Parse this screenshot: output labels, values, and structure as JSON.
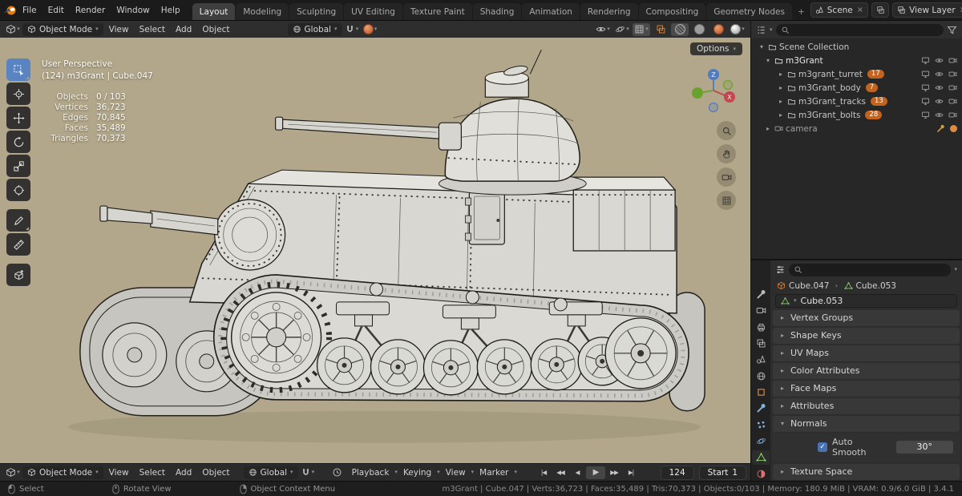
{
  "topbar": {
    "menus": [
      "File",
      "Edit",
      "Render",
      "Window",
      "Help"
    ],
    "tabs": [
      "Layout",
      "Modeling",
      "Sculpting",
      "UV Editing",
      "Texture Paint",
      "Shading",
      "Animation",
      "Rendering",
      "Compositing",
      "Geometry Nodes"
    ],
    "add_tab": "+",
    "scene_label": "Scene",
    "view_layer_label": "View Layer"
  },
  "viewport_header": {
    "mode": "Object Mode",
    "menus": [
      "View",
      "Select",
      "Add",
      "Object"
    ],
    "orientation": "Global",
    "options_label": "Options"
  },
  "viewport": {
    "view_label": "User Perspective",
    "object_label": "(124) m3Grant | Cube.047",
    "stats": [
      {
        "label": "Objects",
        "value": "0 / 103"
      },
      {
        "label": "Vertices",
        "value": "36,723"
      },
      {
        "label": "Edges",
        "value": "70,845"
      },
      {
        "label": "Faces",
        "value": "35,489"
      },
      {
        "label": "Triangles",
        "value": "70,373"
      }
    ],
    "gizmo": {
      "x": "X",
      "z": "Z"
    }
  },
  "outliner": {
    "root_label": "Scene Collection",
    "collection_label": "m3Grant",
    "children": [
      {
        "label": "m3grant_turret",
        "count": "17"
      },
      {
        "label": "m3Grant_body",
        "count": "7"
      },
      {
        "label": "m3Grant_tracks",
        "count": "13"
      },
      {
        "label": "m3Grant_bolts",
        "count": "28"
      }
    ],
    "camera_label": "camera"
  },
  "properties": {
    "breadcrumb_object": "Cube.047",
    "breadcrumb_data": "Cube.053",
    "data_name": "Cube.053",
    "panels": [
      "Vertex Groups",
      "Shape Keys",
      "UV Maps",
      "Color Attributes",
      "Face Maps",
      "Attributes"
    ],
    "normals_title": "Normals",
    "auto_smooth_label": "Auto Smooth",
    "auto_smooth_angle": "30°",
    "texture_space_label": "Texture Space"
  },
  "timeline": {
    "mode": "Object Mode",
    "menus": [
      "View",
      "Select",
      "Add",
      "Object"
    ],
    "orientation": "Global",
    "anim_menus": [
      "Playback",
      "Keying",
      "View",
      "Marker"
    ],
    "frame": "124",
    "start_label": "Start",
    "start_value": "1"
  },
  "statusbar": {
    "hints": [
      "Select",
      "Rotate View",
      "Object Context Menu"
    ],
    "info": "m3Grant | Cube.047 | Verts:36,723 | Faces:35,489 | Tris:70,373 | Objects:0/103 | Memory: 180.9 MiB | VRAM: 0.9/6.0 GiB | 3.4.1"
  },
  "colors": {
    "accent_blue": "#4772b3",
    "viewport_background": "#b2a78b",
    "collection_badge_orange": "#c2641f",
    "active_tool_blue": "#5a83c2"
  }
}
